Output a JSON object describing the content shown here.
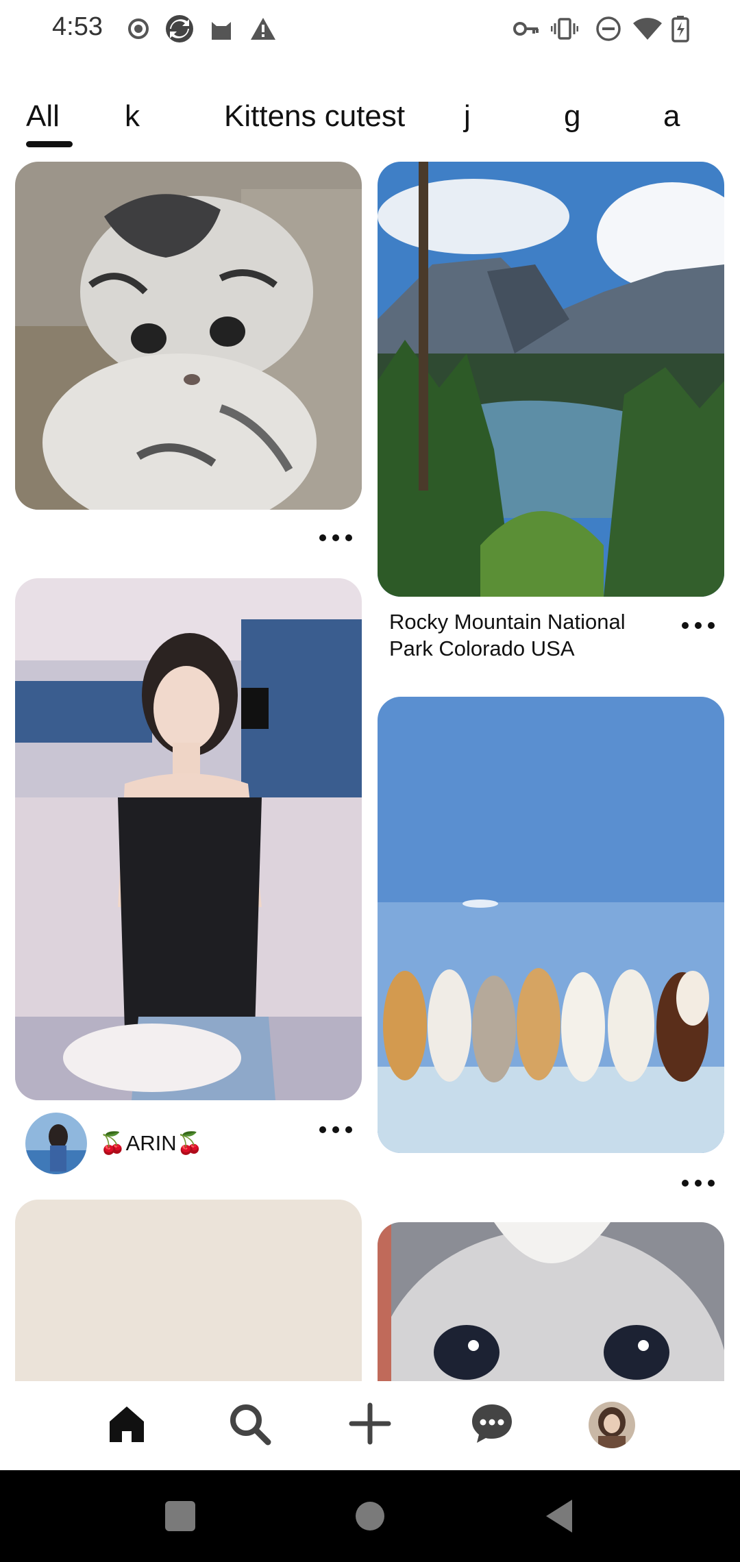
{
  "status_bar": {
    "time": "4:53",
    "left_icons": [
      "record-icon",
      "sync-app-icon",
      "cat-app-icon",
      "warning-icon"
    ],
    "right_icons": [
      "key-icon",
      "vibrate-icon",
      "do-not-disturb-icon",
      "wifi-icon",
      "battery-charging-icon"
    ]
  },
  "tabs": {
    "items": [
      "All",
      "k",
      "Kittens cutest",
      "j",
      "g",
      "a"
    ],
    "selected": "All"
  },
  "feed": {
    "pins": [
      {
        "image": "gray tabby kitten",
        "title": "",
        "author": ""
      },
      {
        "image": "mountain lake landscape",
        "title_line1": "Rocky Mountain National",
        "title_line2": "Park Colorado USA"
      },
      {
        "image": "woman holding skateboard",
        "author": "🍒ARIN🍒"
      },
      {
        "image": "row of cats on wall under blue sky",
        "title": ""
      },
      {
        "image": "beige background",
        "title": ""
      },
      {
        "image": "fluffy cat close-up",
        "title": ""
      }
    ],
    "more_icon": "more-horizontal-icon"
  },
  "bottom_nav": {
    "items": [
      "home-icon",
      "search-icon",
      "add-icon",
      "messages-icon",
      "profile-avatar"
    ],
    "active": "home-icon"
  },
  "system_nav": {
    "items": [
      "recents-square-icon",
      "home-circle-icon",
      "back-triangle-icon"
    ]
  },
  "colors": {
    "text": "#111111",
    "background": "#ffffff",
    "system_nav": "#000000"
  }
}
